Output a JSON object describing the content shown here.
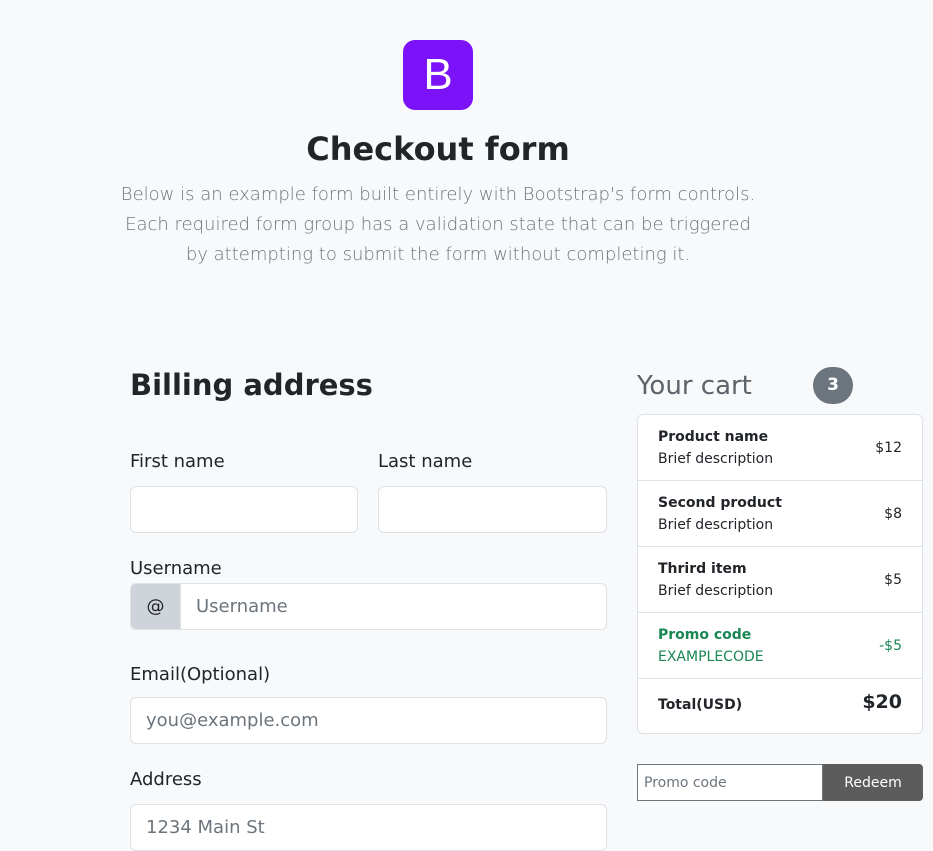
{
  "header": {
    "logo_letter": "B",
    "title": "Checkout form",
    "lead": "Below is an example form built entirely with Bootstrap's form controls. Each required form group has a validation state that can be triggered by attempting to submit the form without completing it."
  },
  "billing": {
    "heading": "Billing address",
    "first_name_label": "First name",
    "first_name_value": "",
    "last_name_label": "Last name",
    "last_name_value": "",
    "username_label": "Username",
    "username_addon": "@",
    "username_placeholder": "Username",
    "email_label": "Email(Optional)",
    "email_placeholder": "you@example.com",
    "address_label": "Address",
    "address_placeholder": "1234 Main St"
  },
  "cart": {
    "heading": "Your cart",
    "count": "3",
    "items": [
      {
        "name": "Product name",
        "description": "Brief description",
        "price": "$12"
      },
      {
        "name": "Second product",
        "description": "Brief description",
        "price": "$8"
      },
      {
        "name": "Thrird item",
        "description": "Brief description",
        "price": "$5"
      }
    ],
    "promo": {
      "name": "Promo code",
      "code": "EXAMPLECODE",
      "amount": "-$5"
    },
    "total": {
      "label": "Total(USD)",
      "amount": "$20"
    },
    "promo_input_placeholder": "Promo code",
    "redeem_label": "Redeem"
  },
  "colors": {
    "brand": "#7c12f8",
    "success": "#198754",
    "secondary": "#6c757d"
  }
}
